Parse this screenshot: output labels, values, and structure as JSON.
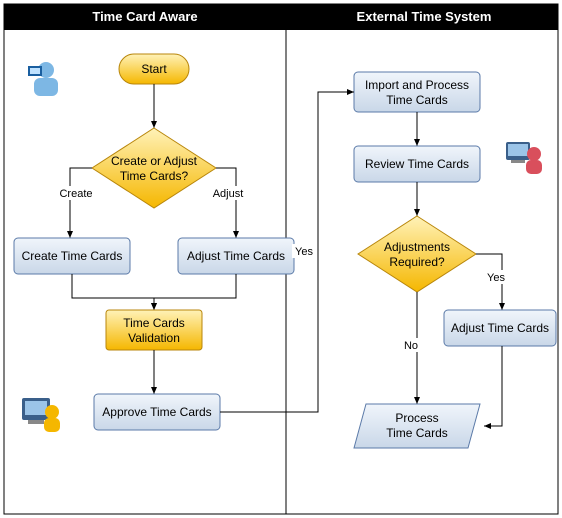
{
  "lanes": {
    "left": "Time Card Aware",
    "right": "External Time System"
  },
  "nodes": {
    "start": "Start",
    "decision1a": "Create or Adjust",
    "decision1b": "Time Cards?",
    "edgeCreate": "Create",
    "edgeAdjust": "Adjust",
    "createTC": "Create Time Cards",
    "adjustTC": "Adjust Time Cards",
    "validateA": "Time Cards",
    "validateB": "Validation",
    "approve": "Approve Time Cards",
    "importA": "Import and Process",
    "importB": "Time Cards",
    "review": "Review Time Cards",
    "decision2a": "Adjustments",
    "decision2b": "Required?",
    "edgeYes": "Yes",
    "edgeNo": "No",
    "edgeYes2": "Yes",
    "adjustTC2": "Adjust Time Cards",
    "processA": "Process",
    "processB": "Time Cards"
  }
}
